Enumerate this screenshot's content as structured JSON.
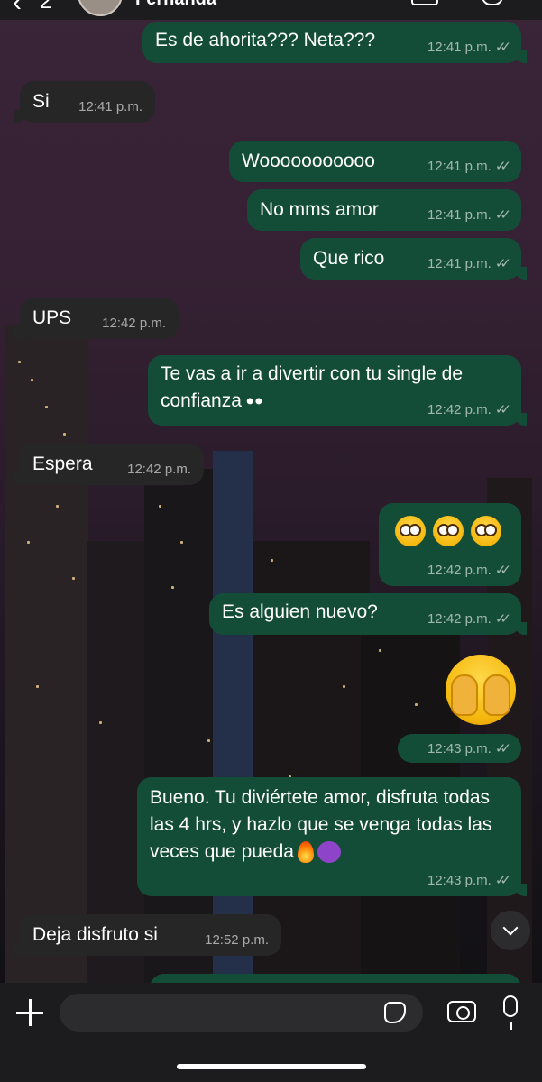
{
  "header": {
    "back_count": "2",
    "contact_name": "Fernanda"
  },
  "messages": [
    {
      "dir": "out",
      "text": "Es de ahorita??? Neta???",
      "time": "12:41 p.m."
    },
    {
      "dir": "in",
      "text": "Si",
      "time": "12:41 p.m."
    },
    {
      "dir": "out",
      "text": "Wooooooooooo",
      "time": "12:41 p.m."
    },
    {
      "dir": "out",
      "text": "No mms amor",
      "time": "12:41 p.m."
    },
    {
      "dir": "out",
      "text": "Que rico",
      "time": "12:41 p.m."
    },
    {
      "dir": "in",
      "text": "UPS",
      "time": "12:42 p.m."
    },
    {
      "dir": "out",
      "text": "Te vas a ir a divertir con tu single de confianza",
      "time": "12:42 p.m.",
      "emoji": "eyes"
    },
    {
      "dir": "in",
      "text": "Espera",
      "time": "12:42 p.m."
    },
    {
      "dir": "out",
      "text": "",
      "time": "12:42 p.m.",
      "emoji": "flushed-face x3"
    },
    {
      "dir": "out",
      "text": "Es alguien nuevo?",
      "time": "12:42 p.m."
    },
    {
      "dir": "out",
      "text": "",
      "time": "12:43 p.m.",
      "emoji": "face-with-hands-over-eyes"
    },
    {
      "dir": "out",
      "text": "Bueno. Tu diviértete amor, disfruta todas las 4 hrs, y hazlo que se venga todas las veces que pueda",
      "time": "12:43 p.m.",
      "emoji": "fire, smiling-devil"
    },
    {
      "dir": "in",
      "text": "Deja disfruto si",
      "time": "12:52 p.m."
    }
  ],
  "read_status_icon": "double-check-icon",
  "input": {
    "placeholder": "",
    "value": ""
  },
  "icons": {
    "add": "plus-icon",
    "sticker": "sticker-icon",
    "camera": "camera-icon",
    "mic": "microphone-icon",
    "scroll": "chevron-down-icon"
  },
  "colors": {
    "outgoing_bubble": "#144d37",
    "incoming_bubble": "#262626",
    "bar_background": "#1c1c1e"
  }
}
